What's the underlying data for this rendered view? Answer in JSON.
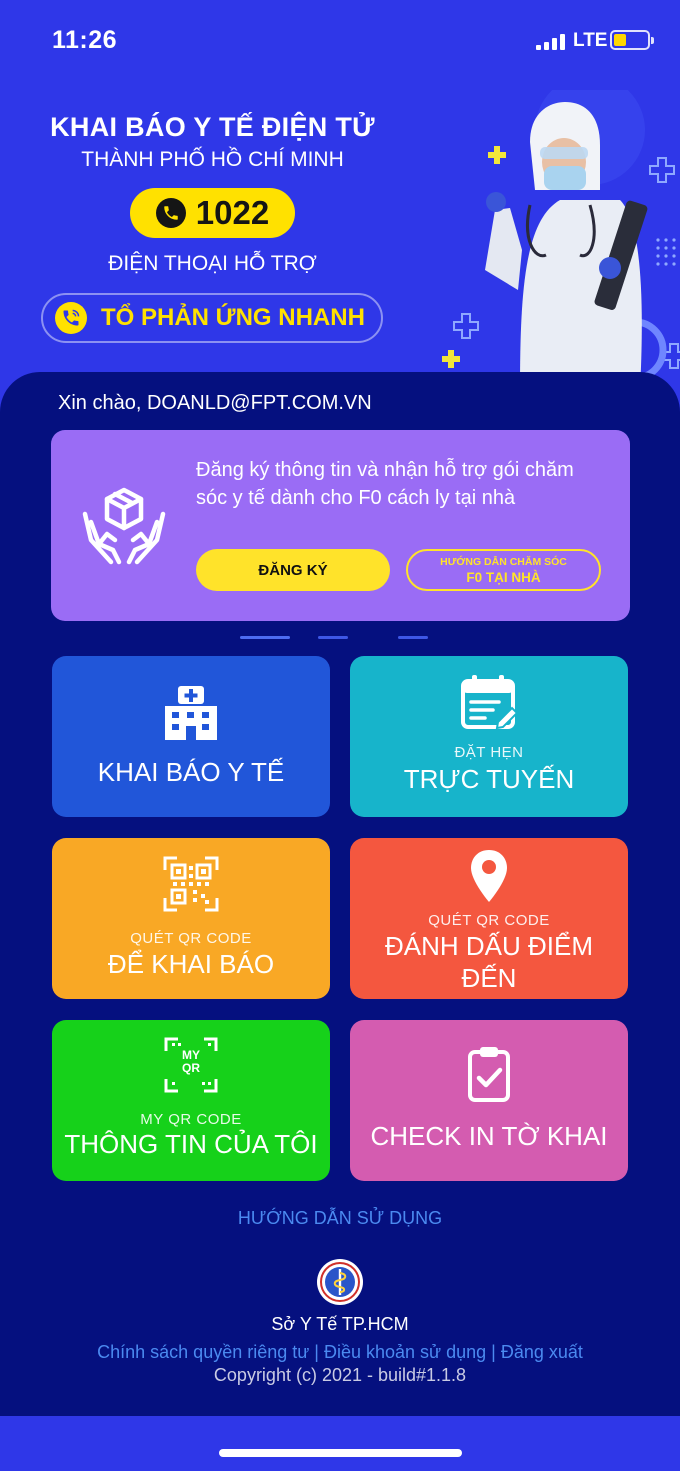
{
  "status_bar": {
    "time": "11:26",
    "network": "LTE",
    "battery_color": "#ffd600"
  },
  "hero": {
    "title": "KHAI BÁO Y TẾ ĐIỆN TỬ",
    "subtitle": "THÀNH PHỐ HỒ CHÍ MINH",
    "hotline_number": "1022",
    "hotline_icon": "phone-icon",
    "support_label": "ĐIỆN THOẠI HỖ TRỢ",
    "rapid_response_label": "TỔ PHẢN ỨNG NHANH",
    "rapid_response_icon": "phone-ringing-icon",
    "accent_color": "#ffe100"
  },
  "main": {
    "greeting": "Xin chào, DOANLD@FPT.COM.VN",
    "banner": {
      "icon": "hands-holding-box-icon",
      "text": "Đăng ký thông tin và nhận hỗ trợ gói chăm sóc y tế dành cho F0 cách ly tại nhà",
      "register_button": "ĐĂNG KÝ",
      "guide_button_line1": "HƯỚNG DẪN CHĂM SÓC",
      "guide_button_line2": "F0 TẠI NHÀ",
      "background_color": "#9a6cf5"
    },
    "tiles": {
      "medical_declaration": {
        "label": "KHAI BÁO Y TẾ",
        "icon": "hospital-icon",
        "color": "#2156d9"
      },
      "online_booking": {
        "sub_label": "ĐẶT HẸN",
        "label": "TRỰC TUYẾN",
        "icon": "calendar-edit-icon",
        "color": "#17b4cb"
      },
      "scan_declare": {
        "sub_label": "QUÉT QR CODE",
        "label": "ĐỂ KHAI BÁO",
        "icon": "qr-scan-icon",
        "color": "#f9a825"
      },
      "scan_checkin": {
        "sub_label": "QUÉT QR CODE",
        "label_line1": "ĐÁNH DẤU ĐIỂM",
        "label_line2": "ĐẾN",
        "icon": "location-pin-icon",
        "color": "#f4573f"
      },
      "my_qr": {
        "sub_label": "MY QR CODE",
        "label": "THÔNG TIN CỦA TÔI",
        "icon": "my-qr-icon",
        "icon_text_top": "MY",
        "icon_text_bottom": "QR",
        "color": "#16d11a"
      },
      "check_in_form": {
        "label": "CHECK IN TỜ KHAI",
        "icon": "clipboard-check-icon",
        "color": "#d45cb0"
      }
    },
    "guide_link": "HƯỚNG DẪN SỬ DỤNG"
  },
  "footer": {
    "seal_icon": "health-department-seal-icon",
    "organization": "Sở Y Tế TP.HCM",
    "policy_links": "Chính sách quyền riêng tư | Điều khoản sử dụng | Đăng xuất",
    "copyright": "Copyright (c) 2021 - build#1.1.8",
    "link_color": "#4b8af0"
  }
}
